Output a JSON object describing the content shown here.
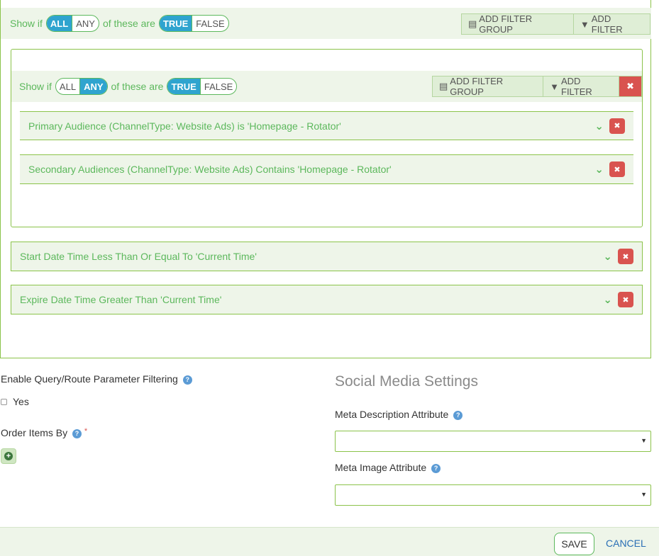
{
  "outer_group": {
    "show_if": "Show if",
    "all": "ALL",
    "any": "ANY",
    "of_these_are": "of these are",
    "true": "TRUE",
    "false": "FALSE",
    "add_filter_group": "ADD FILTER GROUP",
    "add_filter": "ADD FILTER"
  },
  "inner_group": {
    "show_if": "Show if",
    "all": "ALL",
    "any": "ANY",
    "of_these_are": "of these are",
    "true": "TRUE",
    "false": "FALSE",
    "add_filter_group": "ADD FILTER GROUP",
    "add_filter": "ADD FILTER",
    "remove": "✖",
    "filters": [
      "Primary Audience (ChannelType: Website Ads) is 'Homepage - Rotator'",
      "Secondary Audiences (ChannelType: Website Ads) Contains 'Homepage - Rotator'"
    ]
  },
  "outer_filters": [
    "Start Date Time Less Than Or Equal To 'Current Time'",
    "Expire Date Time Greater Than 'Current Time'"
  ],
  "form": {
    "enable_query_label": "Enable Query/Route Parameter Filtering",
    "yes_label": "Yes",
    "order_items_label": "Order Items By",
    "required_mark": "*",
    "social_media_title": "Social Media Settings",
    "meta_description_label": "Meta Description Attribute",
    "meta_image_label": "Meta Image Attribute",
    "meta_description_value": "",
    "meta_image_value": ""
  },
  "footer": {
    "save": "SAVE",
    "cancel": "CANCEL"
  },
  "colors": {
    "accent_green": "#5cb85c",
    "active_blue": "#2fa4cf",
    "danger_red": "#d9534f"
  }
}
